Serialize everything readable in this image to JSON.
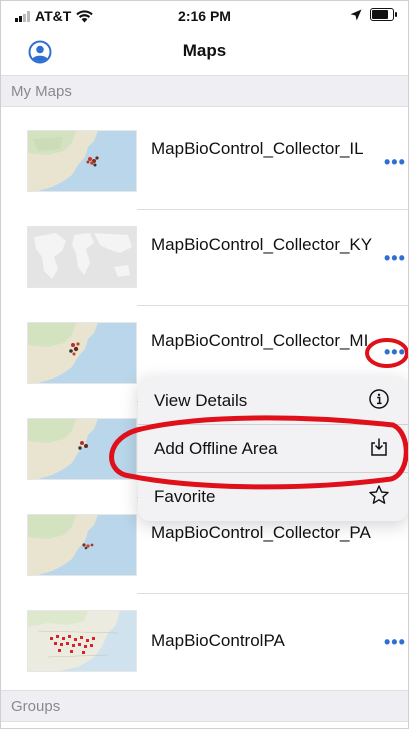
{
  "status_bar": {
    "carrier": "AT&T",
    "time": "2:16 PM"
  },
  "nav": {
    "title": "Maps"
  },
  "sections": {
    "my_maps": "My Maps",
    "groups": "Groups"
  },
  "maps": [
    {
      "name": "MapBioControl_Collector_IL"
    },
    {
      "name": "MapBioControl_Collector_KY"
    },
    {
      "name": "MapBioControl_Collector_MI"
    },
    {
      "name": ""
    },
    {
      "name": "MapBioControl_Collector_PA"
    },
    {
      "name": "MapBioControlPA"
    }
  ],
  "more_glyph": "•••",
  "context_menu": {
    "items": [
      {
        "label": "View Details",
        "icon": "info-circle-icon"
      },
      {
        "label": "Add Offline Area",
        "icon": "download-tray-icon"
      },
      {
        "label": "Favorite",
        "icon": "star-outline-icon"
      }
    ]
  },
  "colors": {
    "accent": "#2f6fd1",
    "annotation": "#e0101a",
    "section_bg": "#efeff3"
  }
}
